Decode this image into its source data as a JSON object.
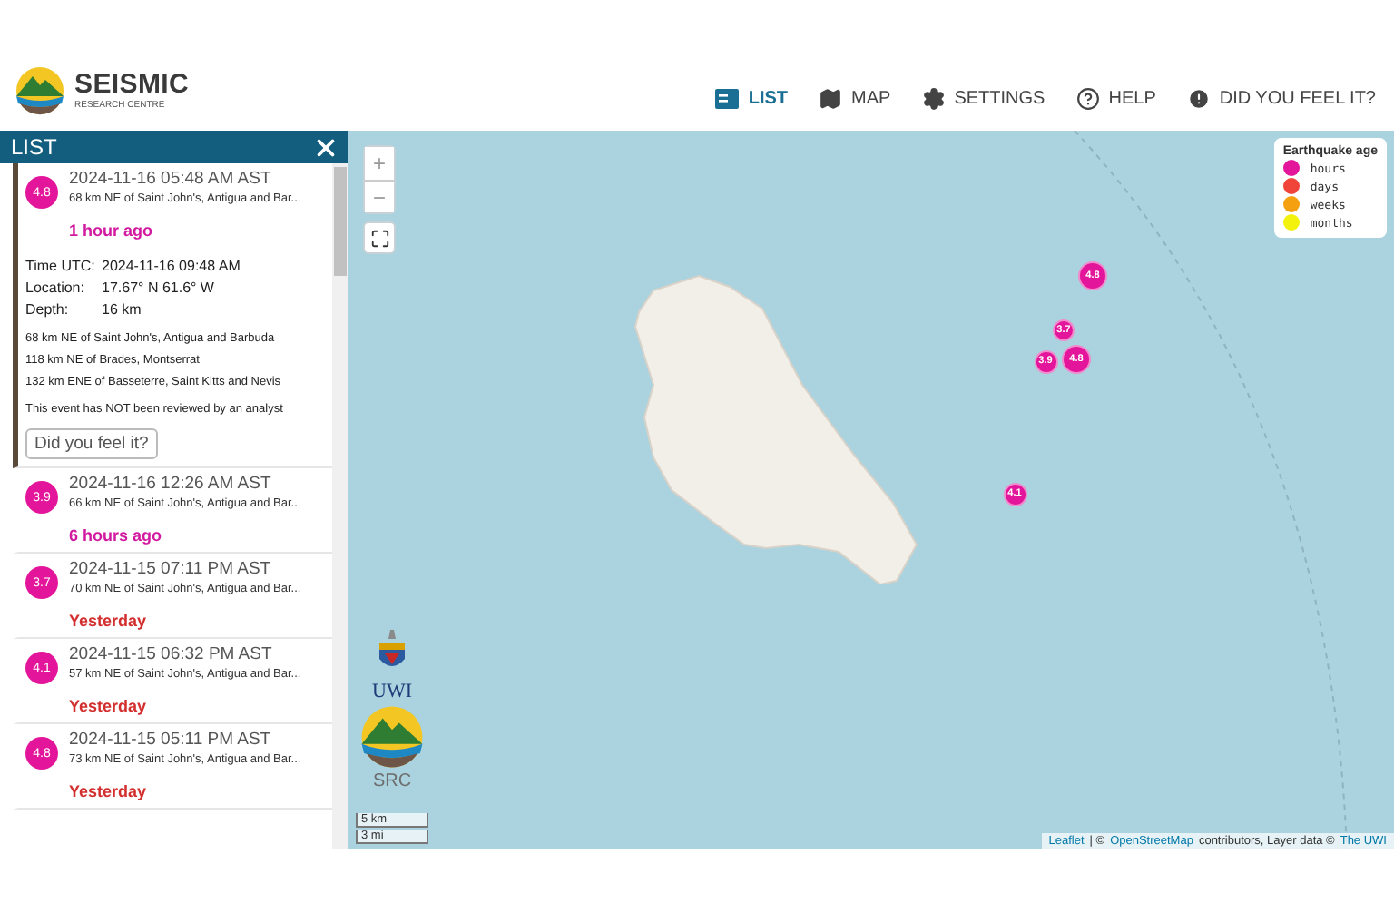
{
  "header": {
    "logo": {
      "title": "SEISMIC",
      "subtitle": "RESEARCH CENTRE"
    },
    "nav": [
      {
        "label": "LIST",
        "selected": true
      },
      {
        "label": "MAP",
        "selected": false
      },
      {
        "label": "SETTINGS",
        "selected": false
      },
      {
        "label": "HELP",
        "selected": false
      },
      {
        "label": "DID YOU FEEL IT?",
        "selected": false
      }
    ]
  },
  "list_panel": {
    "title": "LIST",
    "events": [
      {
        "magnitude": "4.8",
        "color": "#e3169b",
        "time": "2024-11-16 05:48 AM AST",
        "place": "68 km NE of Saint John's, Antigua and Bar...",
        "age": "1 hour ago",
        "kind": "hours",
        "expanded": true,
        "details": {
          "rows": [
            {
              "label": "Time UTC:",
              "value": "2024-11-16 09:48 AM"
            },
            {
              "label": "Location:",
              "value": "17.67° N 61.6° W"
            },
            {
              "label": "Depth:",
              "value": "16 km"
            }
          ],
          "nearby": [
            "68 km NE of Saint John's, Antigua and Barbuda",
            "118 km NE of Brades, Montserrat",
            "132 km ENE of Basseterre, Saint Kitts and Nevis"
          ],
          "review": "This event has NOT been reviewed by an analyst",
          "button": "Did you feel it?"
        }
      },
      {
        "magnitude": "3.9",
        "color": "#e3169b",
        "time": "2024-11-16 12:26 AM AST",
        "place": "66 km NE of Saint John's, Antigua and Bar...",
        "age": "6 hours ago",
        "kind": "hours",
        "expanded": false
      },
      {
        "magnitude": "3.7",
        "color": "#e3169b",
        "time": "2024-11-15 07:11 PM AST",
        "place": "70 km NE of Saint John's, Antigua and Bar...",
        "age": "Yesterday",
        "kind": "days",
        "expanded": false
      },
      {
        "magnitude": "4.1",
        "color": "#e3169b",
        "time": "2024-11-15 06:32 PM AST",
        "place": "57 km NE of Saint John's, Antigua and Bar...",
        "age": "Yesterday",
        "kind": "days",
        "expanded": false
      },
      {
        "magnitude": "4.8",
        "color": "#e3169b",
        "time": "2024-11-15 05:11 PM AST",
        "place": "73 km NE of Saint John's, Antigua and Bar...",
        "age": "Yesterday",
        "kind": "days",
        "expanded": false
      }
    ]
  },
  "map": {
    "zoom_in": "+",
    "zoom_out": "−",
    "markers": [
      {
        "label": "4.8",
        "color": "#e3169b"
      },
      {
        "label": "3.7",
        "color": "#e3169b"
      },
      {
        "label": "3.9",
        "color": "#e3169b"
      },
      {
        "label": "4.8",
        "color": "#e3169b"
      },
      {
        "label": "4.1",
        "color": "#e3169b"
      }
    ],
    "legend": {
      "title": "Earthquake age",
      "items": [
        {
          "label": "hours",
          "color": "#e3169b"
        },
        {
          "label": "days",
          "color": "#f0443a"
        },
        {
          "label": "weeks",
          "color": "#f5a10f"
        },
        {
          "label": "months",
          "color": "#f2f20c"
        }
      ]
    },
    "logos": [
      "UWI",
      "SRC"
    ],
    "scale": [
      "5 km",
      "3 mi"
    ],
    "attribution": [
      {
        "text": "Leaflet",
        "kind": "link"
      },
      {
        "text": "| ©",
        "kind": "text"
      },
      {
        "text": "OpenStreetMap",
        "kind": "link"
      },
      {
        "text": "contributors, Layer data ©",
        "kind": "text"
      },
      {
        "text": "The UWI",
        "kind": "link"
      }
    ]
  }
}
